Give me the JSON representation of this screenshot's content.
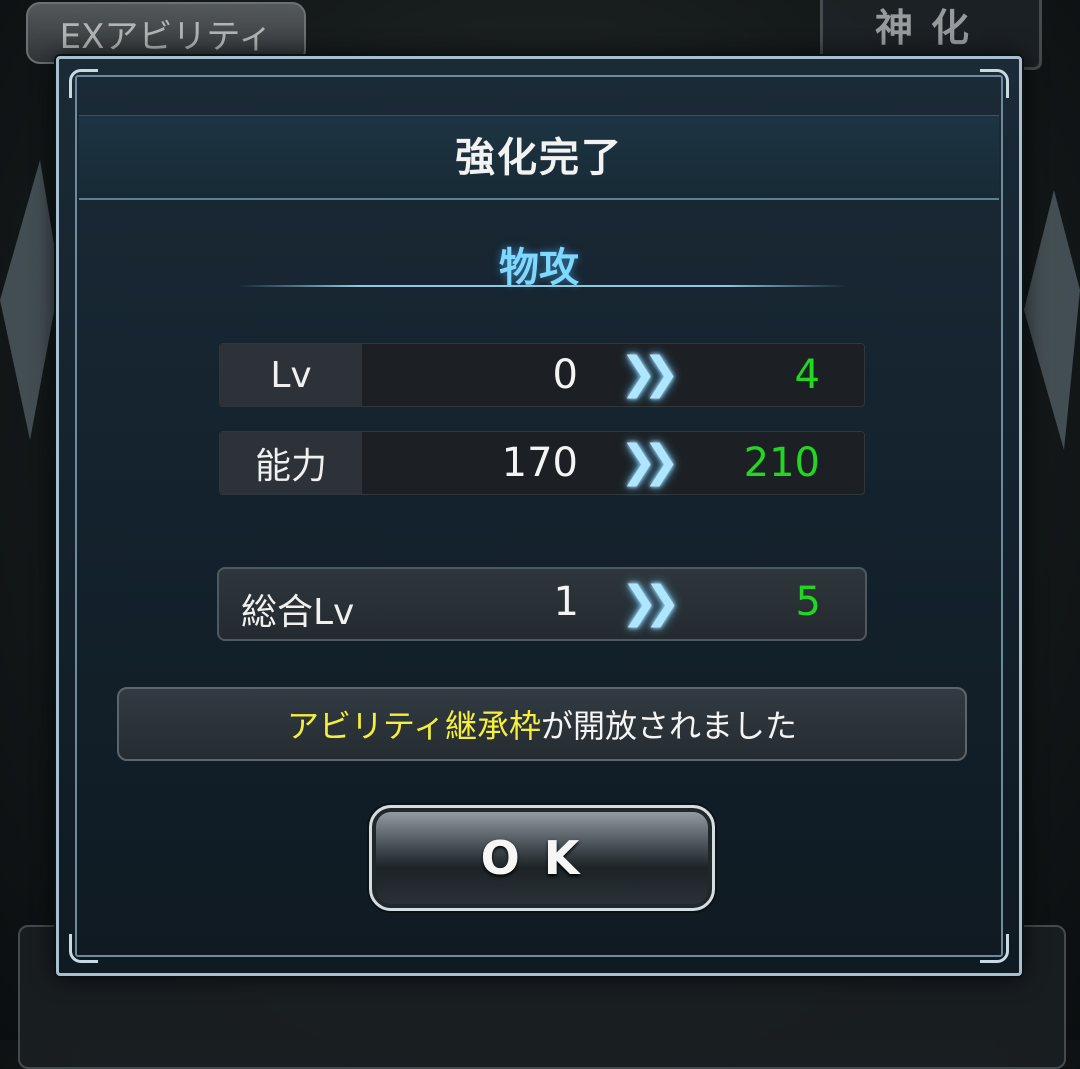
{
  "background": {
    "tab_label": "EXアビリティ",
    "kami_label": "神化"
  },
  "dialog": {
    "title": "強化完了",
    "stat_name": "物攻",
    "rows": [
      {
        "label": "Lv",
        "old": "0",
        "new": "4"
      },
      {
        "label": "能力",
        "old": "170",
        "new": "210"
      }
    ],
    "total": {
      "label": "総合Lv",
      "old": "1",
      "new": "5"
    },
    "arrow_glyph": "❯❯",
    "notice": {
      "highlight": "アビリティ継承枠",
      "rest": "が開放されました"
    },
    "ok_label": "OK"
  },
  "colors": {
    "new_value": "#22d622",
    "highlight": "#f5ef3c",
    "stat_name": "#7fd9ff"
  }
}
